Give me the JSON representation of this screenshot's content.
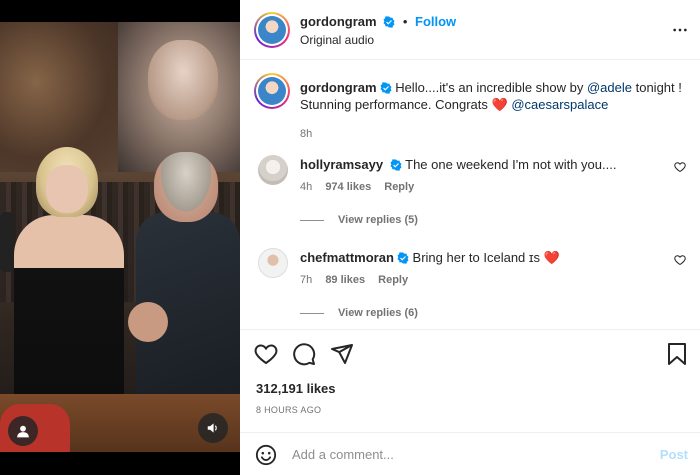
{
  "post": {
    "username": "gordongram",
    "follow_label": "Follow",
    "audio_label": "Original audio"
  },
  "caption": {
    "username": "gordongram",
    "text_1": "Hello....it's an incredible show by ",
    "mention_1": "@adele",
    "text_2": " tonight ! Stunning performance. Congrats ",
    "heart": "❤️",
    "mention_2": "@caesarspalace",
    "time": "8h"
  },
  "comments": [
    {
      "username": "hollyramsayy",
      "text": "The one weekend I'm not with you....",
      "time": "4h",
      "likes": "974 likes",
      "reply_label": "Reply",
      "view_replies": "View replies (5)"
    },
    {
      "username": "chefmattmoran",
      "text": "Bring her to Iceland ",
      "suffix": "ɪs",
      "heart": "❤️",
      "time": "7h",
      "likes": "89 likes",
      "reply_label": "Reply",
      "view_replies": "View replies (6)"
    }
  ],
  "actions": {
    "likes": "312,191 likes",
    "posted_ago": "8 HOURS AGO"
  },
  "composer": {
    "placeholder": "Add a comment...",
    "post_label": "Post"
  },
  "icons": {
    "verified": "verified-badge-icon",
    "more": "more-options-icon",
    "like": "heart-icon",
    "comment": "comment-icon",
    "share": "share-icon",
    "save": "bookmark-icon",
    "emoji": "emoji-icon",
    "user": "user-tags-icon",
    "sound": "sound-icon"
  },
  "colors": {
    "accent": "#0095f6",
    "verified": "#0095f6",
    "mention": "#00376b",
    "heart": "#ed4956",
    "post_disabled": "#b2dffc"
  }
}
